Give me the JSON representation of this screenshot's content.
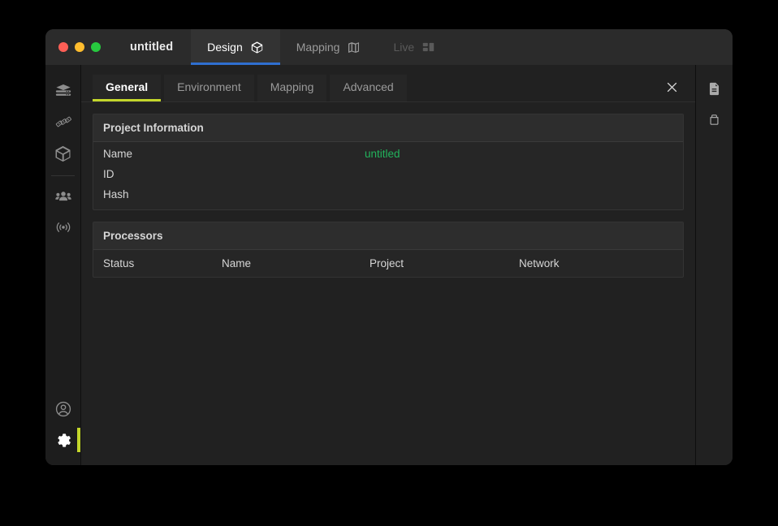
{
  "window": {
    "title": "untitled",
    "traffic_lights": [
      "close",
      "minimize",
      "maximize"
    ],
    "top_tabs": [
      {
        "label": "Design",
        "icon": "cube-icon",
        "state": "active"
      },
      {
        "label": "Mapping",
        "icon": "map-icon",
        "state": "normal"
      },
      {
        "label": "Live",
        "icon": "dashboard-icon",
        "state": "disabled"
      }
    ]
  },
  "left_rail": {
    "items": [
      {
        "name": "server-stack-icon",
        "state": "normal"
      },
      {
        "name": "money-icon",
        "state": "normal"
      },
      {
        "name": "cube-icon",
        "state": "normal"
      },
      {
        "name": "users-icon",
        "state": "normal"
      },
      {
        "name": "broadcast-icon",
        "state": "normal"
      }
    ],
    "bottom_items": [
      {
        "name": "account-icon",
        "state": "normal"
      },
      {
        "name": "settings-icon",
        "state": "active"
      }
    ]
  },
  "right_rail": {
    "items": [
      {
        "name": "document-icon",
        "state": "normal"
      },
      {
        "name": "archive-icon",
        "state": "normal"
      }
    ]
  },
  "panel": {
    "tabs": [
      {
        "label": "General",
        "state": "active"
      },
      {
        "label": "Environment",
        "state": "normal"
      },
      {
        "label": "Mapping",
        "state": "normal"
      },
      {
        "label": "Advanced",
        "state": "normal"
      }
    ],
    "close_label": "✕",
    "project_information": {
      "title": "Project Information",
      "rows": [
        {
          "label": "Name",
          "value": "untitled"
        },
        {
          "label": "ID",
          "value": ""
        },
        {
          "label": "Hash",
          "value": ""
        }
      ]
    },
    "processors": {
      "title": "Processors",
      "columns": [
        "Status",
        "Name",
        "Project",
        "Network"
      ],
      "rows": []
    }
  },
  "colors": {
    "accent_yellow_green": "#c3d62b",
    "accent_blue": "#2f6fd0",
    "value_green": "#22b35c",
    "window_bg": "#2b2b2b",
    "content_bg": "#212121",
    "card_bg": "#262626"
  }
}
